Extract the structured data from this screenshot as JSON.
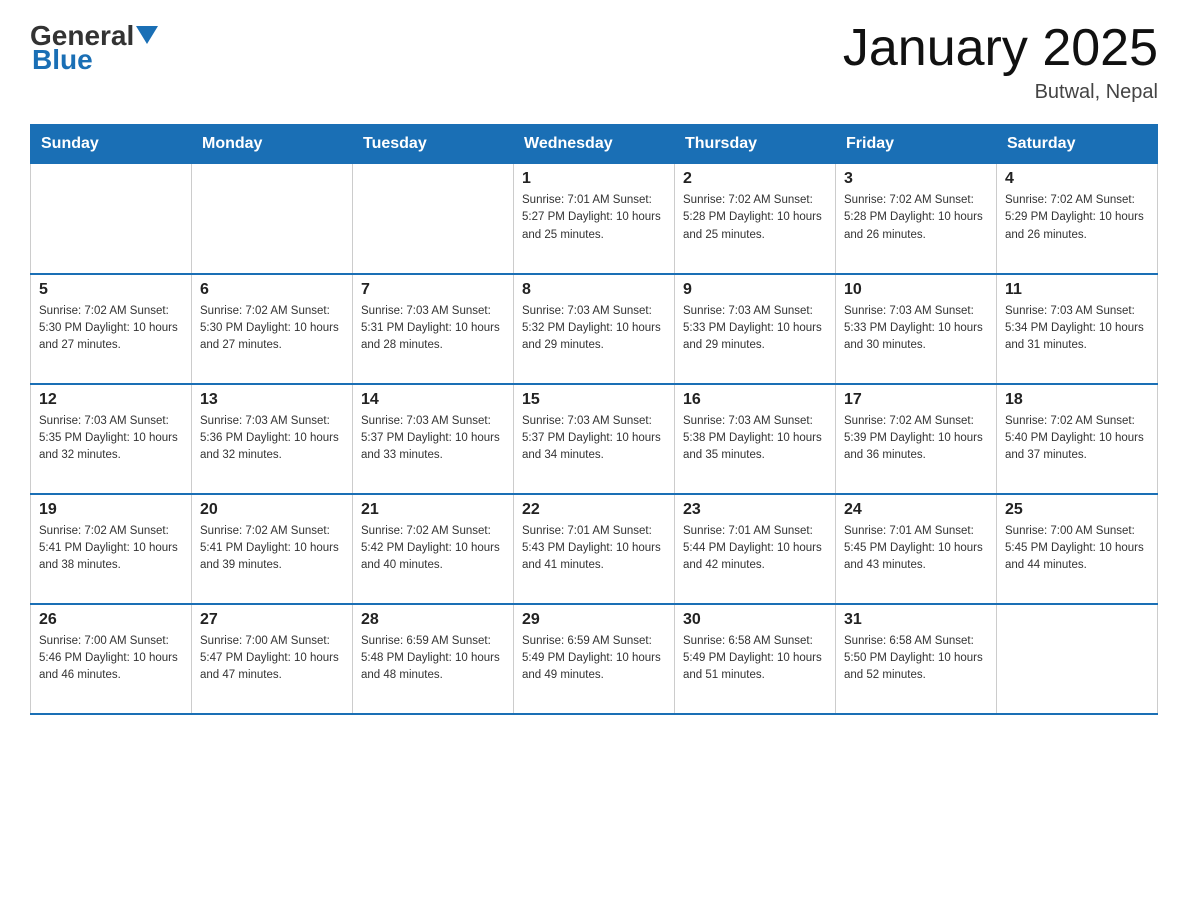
{
  "header": {
    "logo_general": "General",
    "logo_blue": "Blue",
    "title": "January 2025",
    "subtitle": "Butwal, Nepal"
  },
  "days_of_week": [
    "Sunday",
    "Monday",
    "Tuesday",
    "Wednesday",
    "Thursday",
    "Friday",
    "Saturday"
  ],
  "weeks": [
    [
      {
        "day": "",
        "info": ""
      },
      {
        "day": "",
        "info": ""
      },
      {
        "day": "",
        "info": ""
      },
      {
        "day": "1",
        "info": "Sunrise: 7:01 AM\nSunset: 5:27 PM\nDaylight: 10 hours\nand 25 minutes."
      },
      {
        "day": "2",
        "info": "Sunrise: 7:02 AM\nSunset: 5:28 PM\nDaylight: 10 hours\nand 25 minutes."
      },
      {
        "day": "3",
        "info": "Sunrise: 7:02 AM\nSunset: 5:28 PM\nDaylight: 10 hours\nand 26 minutes."
      },
      {
        "day": "4",
        "info": "Sunrise: 7:02 AM\nSunset: 5:29 PM\nDaylight: 10 hours\nand 26 minutes."
      }
    ],
    [
      {
        "day": "5",
        "info": "Sunrise: 7:02 AM\nSunset: 5:30 PM\nDaylight: 10 hours\nand 27 minutes."
      },
      {
        "day": "6",
        "info": "Sunrise: 7:02 AM\nSunset: 5:30 PM\nDaylight: 10 hours\nand 27 minutes."
      },
      {
        "day": "7",
        "info": "Sunrise: 7:03 AM\nSunset: 5:31 PM\nDaylight: 10 hours\nand 28 minutes."
      },
      {
        "day": "8",
        "info": "Sunrise: 7:03 AM\nSunset: 5:32 PM\nDaylight: 10 hours\nand 29 minutes."
      },
      {
        "day": "9",
        "info": "Sunrise: 7:03 AM\nSunset: 5:33 PM\nDaylight: 10 hours\nand 29 minutes."
      },
      {
        "day": "10",
        "info": "Sunrise: 7:03 AM\nSunset: 5:33 PM\nDaylight: 10 hours\nand 30 minutes."
      },
      {
        "day": "11",
        "info": "Sunrise: 7:03 AM\nSunset: 5:34 PM\nDaylight: 10 hours\nand 31 minutes."
      }
    ],
    [
      {
        "day": "12",
        "info": "Sunrise: 7:03 AM\nSunset: 5:35 PM\nDaylight: 10 hours\nand 32 minutes."
      },
      {
        "day": "13",
        "info": "Sunrise: 7:03 AM\nSunset: 5:36 PM\nDaylight: 10 hours\nand 32 minutes."
      },
      {
        "day": "14",
        "info": "Sunrise: 7:03 AM\nSunset: 5:37 PM\nDaylight: 10 hours\nand 33 minutes."
      },
      {
        "day": "15",
        "info": "Sunrise: 7:03 AM\nSunset: 5:37 PM\nDaylight: 10 hours\nand 34 minutes."
      },
      {
        "day": "16",
        "info": "Sunrise: 7:03 AM\nSunset: 5:38 PM\nDaylight: 10 hours\nand 35 minutes."
      },
      {
        "day": "17",
        "info": "Sunrise: 7:02 AM\nSunset: 5:39 PM\nDaylight: 10 hours\nand 36 minutes."
      },
      {
        "day": "18",
        "info": "Sunrise: 7:02 AM\nSunset: 5:40 PM\nDaylight: 10 hours\nand 37 minutes."
      }
    ],
    [
      {
        "day": "19",
        "info": "Sunrise: 7:02 AM\nSunset: 5:41 PM\nDaylight: 10 hours\nand 38 minutes."
      },
      {
        "day": "20",
        "info": "Sunrise: 7:02 AM\nSunset: 5:41 PM\nDaylight: 10 hours\nand 39 minutes."
      },
      {
        "day": "21",
        "info": "Sunrise: 7:02 AM\nSunset: 5:42 PM\nDaylight: 10 hours\nand 40 minutes."
      },
      {
        "day": "22",
        "info": "Sunrise: 7:01 AM\nSunset: 5:43 PM\nDaylight: 10 hours\nand 41 minutes."
      },
      {
        "day": "23",
        "info": "Sunrise: 7:01 AM\nSunset: 5:44 PM\nDaylight: 10 hours\nand 42 minutes."
      },
      {
        "day": "24",
        "info": "Sunrise: 7:01 AM\nSunset: 5:45 PM\nDaylight: 10 hours\nand 43 minutes."
      },
      {
        "day": "25",
        "info": "Sunrise: 7:00 AM\nSunset: 5:45 PM\nDaylight: 10 hours\nand 44 minutes."
      }
    ],
    [
      {
        "day": "26",
        "info": "Sunrise: 7:00 AM\nSunset: 5:46 PM\nDaylight: 10 hours\nand 46 minutes."
      },
      {
        "day": "27",
        "info": "Sunrise: 7:00 AM\nSunset: 5:47 PM\nDaylight: 10 hours\nand 47 minutes."
      },
      {
        "day": "28",
        "info": "Sunrise: 6:59 AM\nSunset: 5:48 PM\nDaylight: 10 hours\nand 48 minutes."
      },
      {
        "day": "29",
        "info": "Sunrise: 6:59 AM\nSunset: 5:49 PM\nDaylight: 10 hours\nand 49 minutes."
      },
      {
        "day": "30",
        "info": "Sunrise: 6:58 AM\nSunset: 5:49 PM\nDaylight: 10 hours\nand 51 minutes."
      },
      {
        "day": "31",
        "info": "Sunrise: 6:58 AM\nSunset: 5:50 PM\nDaylight: 10 hours\nand 52 minutes."
      },
      {
        "day": "",
        "info": ""
      }
    ]
  ]
}
